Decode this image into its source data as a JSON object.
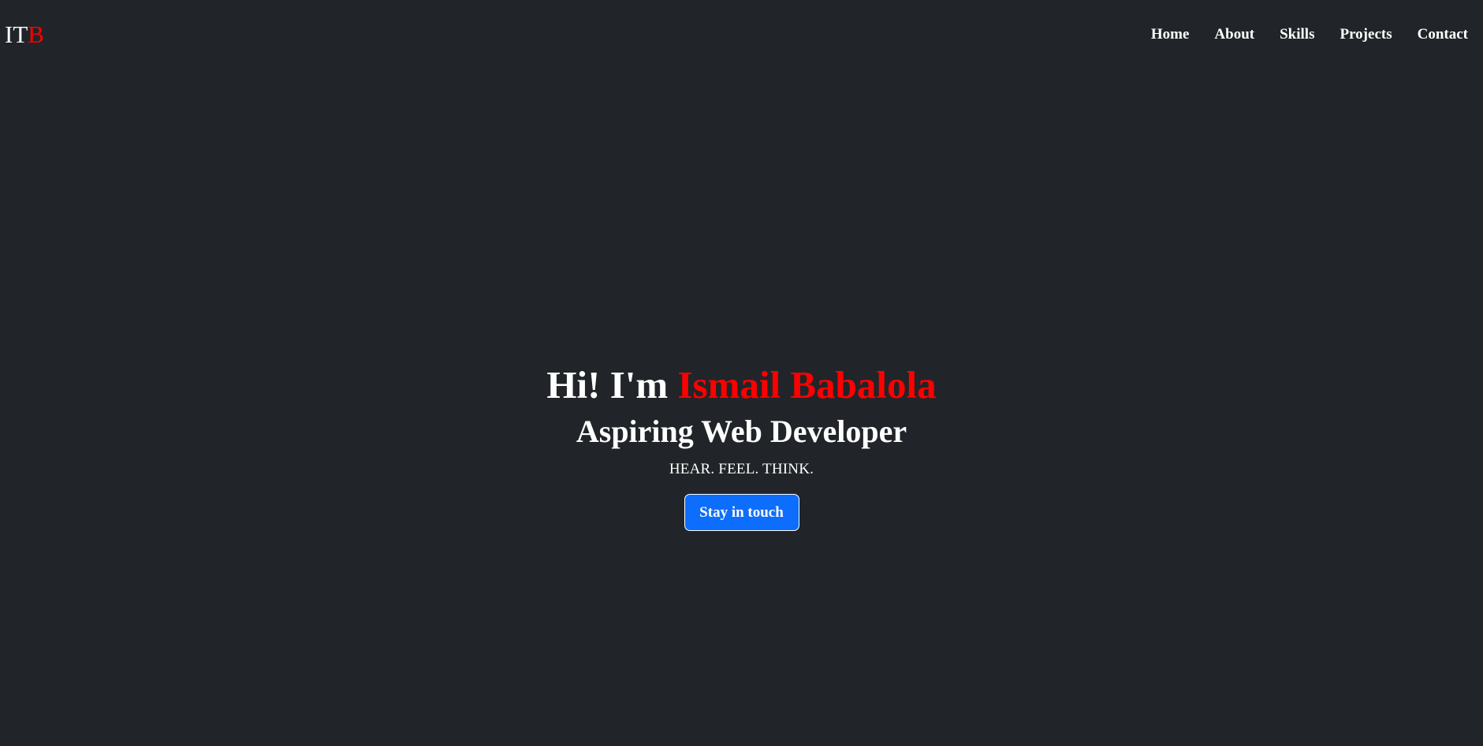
{
  "brand": {
    "prefix": "IT",
    "highlight": "B"
  },
  "nav": {
    "items": [
      {
        "label": "Home"
      },
      {
        "label": "About"
      },
      {
        "label": "Skills"
      },
      {
        "label": "Projects"
      },
      {
        "label": "Contact"
      }
    ]
  },
  "hero": {
    "greeting": "Hi! I'm",
    "name": "Ismail Babalola",
    "subtitle": "Aspiring Web Developer",
    "tagline": "HEAR. FEEL. THINK.",
    "cta_label": "Stay in touch"
  },
  "colors": {
    "background": "#212529",
    "accent": "#ff0000",
    "button": "#0d6efd",
    "text": "#ffffff"
  }
}
